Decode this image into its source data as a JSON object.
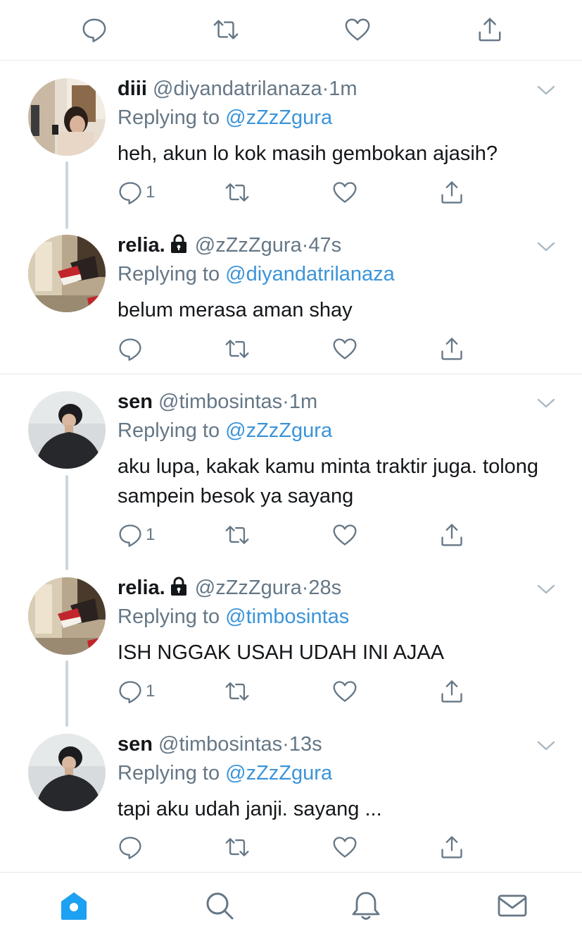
{
  "colors": {
    "accent": "#1da1f2",
    "mention": "#3b94d9",
    "secondary_text": "#657786",
    "primary_text": "#14171a",
    "divider": "#e1e8ed",
    "thread_line": "#ccd6dd"
  },
  "top_actions": {
    "icons": [
      "reply-icon",
      "retweet-icon",
      "like-icon",
      "share-icon"
    ]
  },
  "tweets": [
    {
      "display_name": "diii",
      "locked": false,
      "handle": "@diyandatrilanaza",
      "separator": "·",
      "time": "1m",
      "replying_prefix": "Replying to ",
      "replying_to": "@zZzZgura",
      "text": "heh, akun lo kok masih gembokan ajasih?",
      "reply_count": "1"
    },
    {
      "display_name": "relia.",
      "locked": true,
      "handle": "@zZzZgura",
      "separator": "·",
      "time": "47s",
      "replying_prefix": "Replying to ",
      "replying_to": "@diyandatrilanaza",
      "text": "belum merasa aman shay",
      "reply_count": ""
    },
    {
      "display_name": "sen",
      "locked": false,
      "handle": "@timbosintas",
      "separator": "·",
      "time": "1m",
      "replying_prefix": "Replying to ",
      "replying_to": "@zZzZgura",
      "text": "aku lupa, kakak kamu minta traktir juga. tolong sampein besok ya sayang",
      "reply_count": "1"
    },
    {
      "display_name": "relia.",
      "locked": true,
      "handle": "@zZzZgura",
      "separator": "·",
      "time": "28s",
      "replying_prefix": "Replying to ",
      "replying_to": "@timbosintas",
      "text": "ISH NGGAK USAH UDAH INI AJAA",
      "reply_count": "1"
    },
    {
      "display_name": "sen",
      "locked": false,
      "handle": "@timbosintas",
      "separator": "·",
      "time": "13s",
      "replying_prefix": "Replying to ",
      "replying_to": "@zZzZgura",
      "text": "tapi aku udah janji. sayang ...",
      "reply_count": ""
    }
  ],
  "bottom_nav": {
    "items": [
      "home-icon",
      "search-icon",
      "notifications-icon",
      "messages-icon"
    ],
    "active": "home-icon"
  }
}
